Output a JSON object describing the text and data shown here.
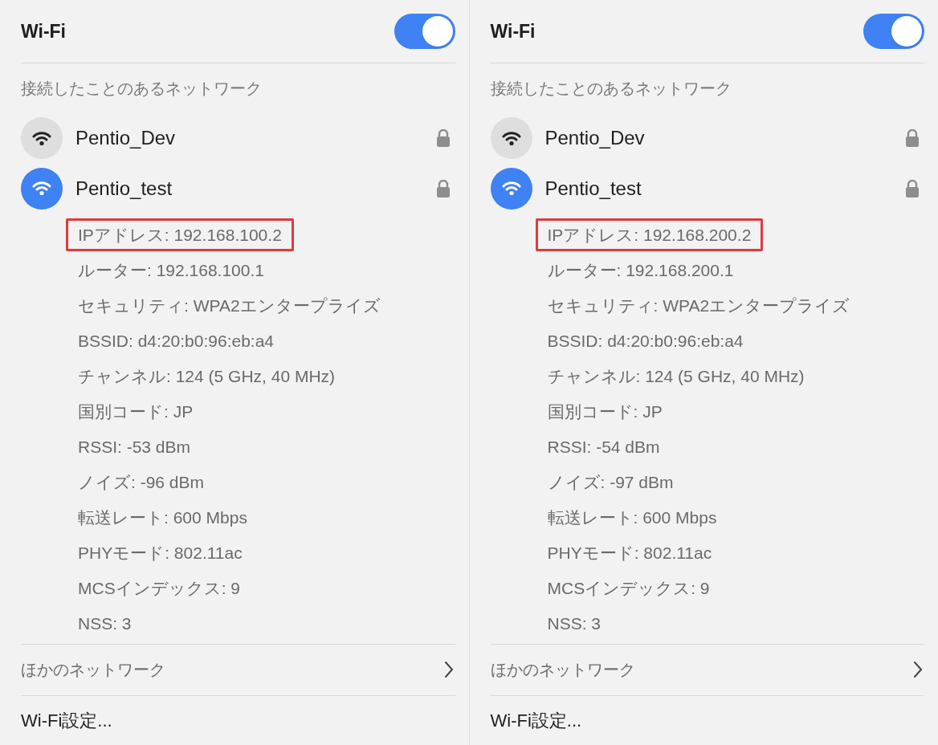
{
  "panels": [
    {
      "title": "Wi-Fi",
      "toggle": {
        "on": true
      },
      "section_title": "接続したことのあるネットワーク",
      "networks": [
        {
          "name": "Pentio_Dev",
          "connected": false,
          "locked": true
        },
        {
          "name": "Pentio_test",
          "connected": true,
          "locked": true
        }
      ],
      "details": [
        {
          "text": "IPアドレス: 192.168.100.2",
          "highlighted": true
        },
        {
          "text": "ルーター: 192.168.100.1",
          "highlighted": false
        },
        {
          "text": "セキュリティ: WPA2エンタープライズ",
          "highlighted": false
        },
        {
          "text": "BSSID: d4:20:b0:96:eb:a4",
          "highlighted": false
        },
        {
          "text": "チャンネル: 124 (5 GHz, 40 MHz)",
          "highlighted": false
        },
        {
          "text": "国別コード: JP",
          "highlighted": false
        },
        {
          "text": "RSSI: -53 dBm",
          "highlighted": false
        },
        {
          "text": "ノイズ: -96 dBm",
          "highlighted": false
        },
        {
          "text": "転送レート: 600 Mbps",
          "highlighted": false
        },
        {
          "text": "PHYモード: 802.11ac",
          "highlighted": false
        },
        {
          "text": "MCSインデックス: 9",
          "highlighted": false
        },
        {
          "text": "NSS: 3",
          "highlighted": false
        }
      ],
      "other_networks": "ほかのネットワーク",
      "settings": "Wi-Fi設定..."
    },
    {
      "title": "Wi-Fi",
      "toggle": {
        "on": true
      },
      "section_title": "接続したことのあるネットワーク",
      "networks": [
        {
          "name": "Pentio_Dev",
          "connected": false,
          "locked": true
        },
        {
          "name": "Pentio_test",
          "connected": true,
          "locked": true
        }
      ],
      "details": [
        {
          "text": "IPアドレス: 192.168.200.2",
          "highlighted": true
        },
        {
          "text": "ルーター: 192.168.200.1",
          "highlighted": false
        },
        {
          "text": "セキュリティ: WPA2エンタープライズ",
          "highlighted": false
        },
        {
          "text": "BSSID: d4:20:b0:96:eb:a4",
          "highlighted": false
        },
        {
          "text": "チャンネル: 124 (5 GHz, 40 MHz)",
          "highlighted": false
        },
        {
          "text": "国別コード: JP",
          "highlighted": false
        },
        {
          "text": "RSSI: -54 dBm",
          "highlighted": false
        },
        {
          "text": "ノイズ: -97 dBm",
          "highlighted": false
        },
        {
          "text": "転送レート: 600 Mbps",
          "highlighted": false
        },
        {
          "text": "PHYモード: 802.11ac",
          "highlighted": false
        },
        {
          "text": "MCSインデックス: 9",
          "highlighted": false
        },
        {
          "text": "NSS: 3",
          "highlighted": false
        }
      ],
      "other_networks": "ほかのネットワーク",
      "settings": "Wi-Fi設定..."
    }
  ]
}
